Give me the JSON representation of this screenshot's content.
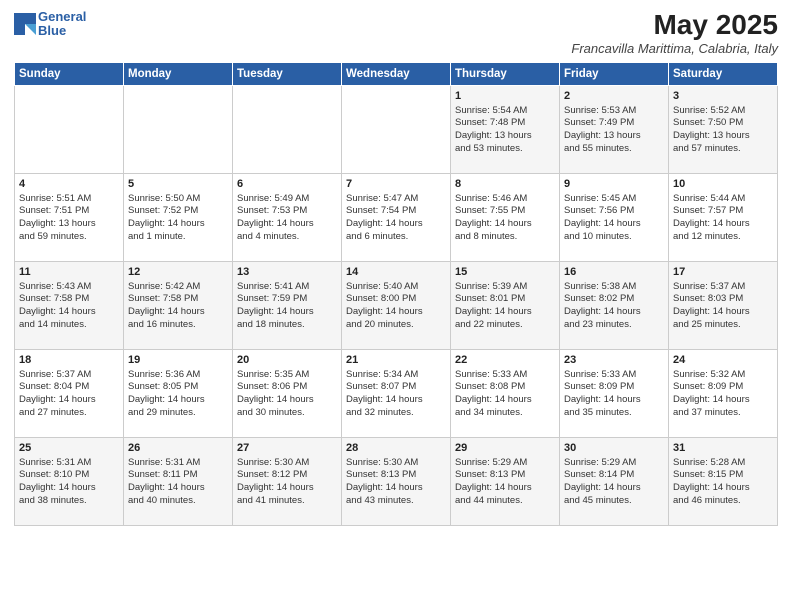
{
  "header": {
    "logo_line1": "General",
    "logo_line2": "Blue",
    "month_year": "May 2025",
    "location": "Francavilla Marittima, Calabria, Italy"
  },
  "days_of_week": [
    "Sunday",
    "Monday",
    "Tuesday",
    "Wednesday",
    "Thursday",
    "Friday",
    "Saturday"
  ],
  "weeks": [
    [
      {
        "day": "",
        "info": ""
      },
      {
        "day": "",
        "info": ""
      },
      {
        "day": "",
        "info": ""
      },
      {
        "day": "",
        "info": ""
      },
      {
        "day": "1",
        "info": "Sunrise: 5:54 AM\nSunset: 7:48 PM\nDaylight: 13 hours\nand 53 minutes."
      },
      {
        "day": "2",
        "info": "Sunrise: 5:53 AM\nSunset: 7:49 PM\nDaylight: 13 hours\nand 55 minutes."
      },
      {
        "day": "3",
        "info": "Sunrise: 5:52 AM\nSunset: 7:50 PM\nDaylight: 13 hours\nand 57 minutes."
      }
    ],
    [
      {
        "day": "4",
        "info": "Sunrise: 5:51 AM\nSunset: 7:51 PM\nDaylight: 13 hours\nand 59 minutes."
      },
      {
        "day": "5",
        "info": "Sunrise: 5:50 AM\nSunset: 7:52 PM\nDaylight: 14 hours\nand 1 minute."
      },
      {
        "day": "6",
        "info": "Sunrise: 5:49 AM\nSunset: 7:53 PM\nDaylight: 14 hours\nand 4 minutes."
      },
      {
        "day": "7",
        "info": "Sunrise: 5:47 AM\nSunset: 7:54 PM\nDaylight: 14 hours\nand 6 minutes."
      },
      {
        "day": "8",
        "info": "Sunrise: 5:46 AM\nSunset: 7:55 PM\nDaylight: 14 hours\nand 8 minutes."
      },
      {
        "day": "9",
        "info": "Sunrise: 5:45 AM\nSunset: 7:56 PM\nDaylight: 14 hours\nand 10 minutes."
      },
      {
        "day": "10",
        "info": "Sunrise: 5:44 AM\nSunset: 7:57 PM\nDaylight: 14 hours\nand 12 minutes."
      }
    ],
    [
      {
        "day": "11",
        "info": "Sunrise: 5:43 AM\nSunset: 7:58 PM\nDaylight: 14 hours\nand 14 minutes."
      },
      {
        "day": "12",
        "info": "Sunrise: 5:42 AM\nSunset: 7:58 PM\nDaylight: 14 hours\nand 16 minutes."
      },
      {
        "day": "13",
        "info": "Sunrise: 5:41 AM\nSunset: 7:59 PM\nDaylight: 14 hours\nand 18 minutes."
      },
      {
        "day": "14",
        "info": "Sunrise: 5:40 AM\nSunset: 8:00 PM\nDaylight: 14 hours\nand 20 minutes."
      },
      {
        "day": "15",
        "info": "Sunrise: 5:39 AM\nSunset: 8:01 PM\nDaylight: 14 hours\nand 22 minutes."
      },
      {
        "day": "16",
        "info": "Sunrise: 5:38 AM\nSunset: 8:02 PM\nDaylight: 14 hours\nand 23 minutes."
      },
      {
        "day": "17",
        "info": "Sunrise: 5:37 AM\nSunset: 8:03 PM\nDaylight: 14 hours\nand 25 minutes."
      }
    ],
    [
      {
        "day": "18",
        "info": "Sunrise: 5:37 AM\nSunset: 8:04 PM\nDaylight: 14 hours\nand 27 minutes."
      },
      {
        "day": "19",
        "info": "Sunrise: 5:36 AM\nSunset: 8:05 PM\nDaylight: 14 hours\nand 29 minutes."
      },
      {
        "day": "20",
        "info": "Sunrise: 5:35 AM\nSunset: 8:06 PM\nDaylight: 14 hours\nand 30 minutes."
      },
      {
        "day": "21",
        "info": "Sunrise: 5:34 AM\nSunset: 8:07 PM\nDaylight: 14 hours\nand 32 minutes."
      },
      {
        "day": "22",
        "info": "Sunrise: 5:33 AM\nSunset: 8:08 PM\nDaylight: 14 hours\nand 34 minutes."
      },
      {
        "day": "23",
        "info": "Sunrise: 5:33 AM\nSunset: 8:09 PM\nDaylight: 14 hours\nand 35 minutes."
      },
      {
        "day": "24",
        "info": "Sunrise: 5:32 AM\nSunset: 8:09 PM\nDaylight: 14 hours\nand 37 minutes."
      }
    ],
    [
      {
        "day": "25",
        "info": "Sunrise: 5:31 AM\nSunset: 8:10 PM\nDaylight: 14 hours\nand 38 minutes."
      },
      {
        "day": "26",
        "info": "Sunrise: 5:31 AM\nSunset: 8:11 PM\nDaylight: 14 hours\nand 40 minutes."
      },
      {
        "day": "27",
        "info": "Sunrise: 5:30 AM\nSunset: 8:12 PM\nDaylight: 14 hours\nand 41 minutes."
      },
      {
        "day": "28",
        "info": "Sunrise: 5:30 AM\nSunset: 8:13 PM\nDaylight: 14 hours\nand 43 minutes."
      },
      {
        "day": "29",
        "info": "Sunrise: 5:29 AM\nSunset: 8:13 PM\nDaylight: 14 hours\nand 44 minutes."
      },
      {
        "day": "30",
        "info": "Sunrise: 5:29 AM\nSunset: 8:14 PM\nDaylight: 14 hours\nand 45 minutes."
      },
      {
        "day": "31",
        "info": "Sunrise: 5:28 AM\nSunset: 8:15 PM\nDaylight: 14 hours\nand 46 minutes."
      }
    ]
  ]
}
